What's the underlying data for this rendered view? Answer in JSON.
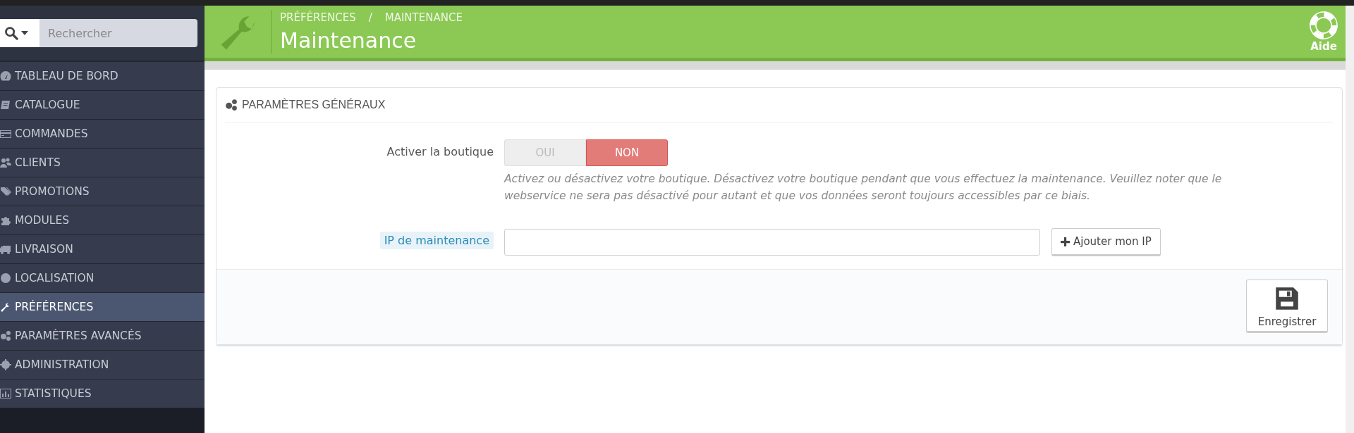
{
  "search": {
    "placeholder": "Rechercher"
  },
  "sidebar": {
    "items": [
      {
        "label": "TABLEAU DE BORD",
        "selected": false
      },
      {
        "label": "CATALOGUE",
        "selected": false
      },
      {
        "label": "COMMANDES",
        "selected": false
      },
      {
        "label": "CLIENTS",
        "selected": false
      },
      {
        "label": "PROMOTIONS",
        "selected": false
      },
      {
        "label": "MODULES",
        "selected": false
      },
      {
        "label": "LIVRAISON",
        "selected": false
      },
      {
        "label": "LOCALISATION",
        "selected": false
      },
      {
        "label": "PRÉFÉRENCES",
        "selected": true
      },
      {
        "label": "PARAMÈTRES AVANCÉS",
        "selected": false
      },
      {
        "label": "ADMINISTRATION",
        "selected": false
      },
      {
        "label": "STATISTIQUES",
        "selected": false
      }
    ]
  },
  "header": {
    "breadcrumb": [
      "PRÉFÉRENCES",
      "MAINTENANCE"
    ],
    "separator": "/",
    "title": "Maintenance",
    "help": "Aide"
  },
  "panel": {
    "title": "PARAMÈTRES GÉNÉRAUX",
    "fields": [
      {
        "kind": "switch",
        "label": "Activer la boutique",
        "options": [
          {
            "label": "OUI",
            "selected": false
          },
          {
            "label": "NON",
            "selected": true
          }
        ],
        "help": "Activez ou désactivez votre boutique. Désactivez votre boutique pendant que vous effectuez la maintenance. Veuillez noter que le webservice ne sera pas désactivé pour autant et que vos données seront toujours accessibles par ce biais."
      },
      {
        "kind": "text",
        "label": "IP de maintenance",
        "button": "Ajouter mon IP"
      }
    ],
    "save": "Enregistrer"
  }
}
